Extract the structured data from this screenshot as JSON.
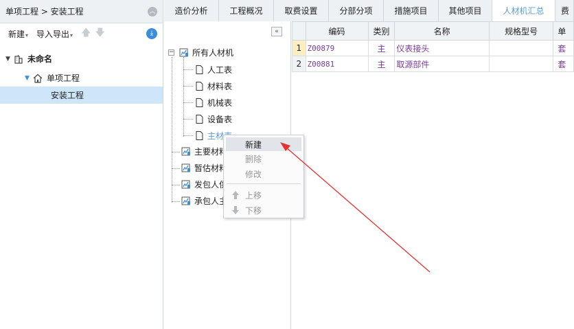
{
  "project_panel": {
    "breadcrumb": "单项工程 > 安装工程",
    "toolbar": {
      "new_label": "新建",
      "import_export_label": "导入导出"
    },
    "tree": [
      {
        "label": "未命名",
        "level": 0
      },
      {
        "label": "单项工程",
        "level": 1
      },
      {
        "label": "安装工程",
        "level": 2,
        "selected": true
      }
    ]
  },
  "tabs": [
    {
      "label": "造价分析"
    },
    {
      "label": "工程概况"
    },
    {
      "label": "取费设置"
    },
    {
      "label": "分部分项"
    },
    {
      "label": "措施项目"
    },
    {
      "label": "其他项目"
    },
    {
      "label": "人材机汇总",
      "active": true
    },
    {
      "label": "费"
    }
  ],
  "material_tree": {
    "root": "所有人材机",
    "children": [
      "人工表",
      "材料表",
      "机械表",
      "设备表",
      "主材表"
    ],
    "groups": [
      "主要材料",
      "暂估材料",
      "发包人供",
      "承包人主"
    ]
  },
  "context_menu": {
    "items": [
      {
        "label": "新建",
        "enabled": true
      },
      {
        "label": "删除",
        "enabled": false
      },
      {
        "label": "修改",
        "enabled": false
      },
      {
        "label": "上移",
        "enabled": false
      },
      {
        "label": "下移",
        "enabled": false
      }
    ]
  },
  "grid": {
    "columns": [
      "编码",
      "类别",
      "名称",
      "规格型号",
      "单"
    ],
    "rows": [
      {
        "num": "1",
        "code": "Z00879",
        "category": "主",
        "name": "仪表接头",
        "spec": "",
        "unit": "套"
      },
      {
        "num": "2",
        "code": "Z00881",
        "category": "主",
        "name": "取源部件",
        "spec": "",
        "unit": "套"
      }
    ]
  },
  "colors": {
    "accent": "#5a9bd8",
    "selection": "#cde6f9",
    "material_text": "#7a3a9a",
    "annotation_arrow": "#e53030"
  }
}
